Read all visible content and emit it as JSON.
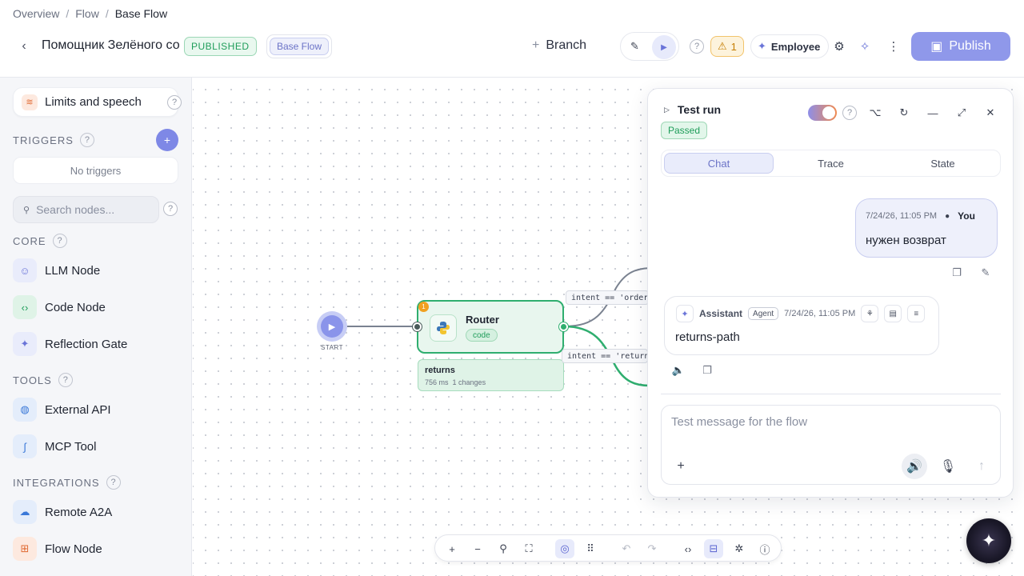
{
  "breadcrumb": {
    "items": [
      "Overview",
      "Flow"
    ],
    "current": "Base Flow"
  },
  "header": {
    "flow_title": "Помощник Зелёного со",
    "status_badge": "PUBLISHED",
    "flow_badge": "Base Flow",
    "branch_label": "Branch",
    "warnings_count": "1",
    "persona_label": "Employee",
    "publish_label": "Publish",
    "help_icon": "?"
  },
  "sidebar": {
    "limits_label": "Limits and speech",
    "triggers_title": "TRIGGERS",
    "no_triggers": "No triggers",
    "search_placeholder": "Search nodes...",
    "core_title": "CORE",
    "core_items": [
      {
        "label": "LLM Node",
        "icon": "robot-icon",
        "color": "#6a74d8"
      },
      {
        "label": "Code Node",
        "icon": "code-icon",
        "color": "#1f9d5a"
      },
      {
        "label": "Reflection Gate",
        "icon": "sparkle-icon",
        "color": "#6a74d8"
      }
    ],
    "tools_title": "TOOLS",
    "tools_items": [
      {
        "label": "External API",
        "icon": "globe-icon",
        "color": "#3a78d8"
      },
      {
        "label": "MCP Tool",
        "icon": "mcp-icon",
        "color": "#3a78d8"
      }
    ],
    "integrations_title": "INTEGRATIONS",
    "integrations_items": [
      {
        "label": "Remote A2A",
        "icon": "cloud-icon",
        "color": "#3a78d8"
      },
      {
        "label": "Flow Node",
        "icon": "flow-icon",
        "color": "#e06a33"
      }
    ]
  },
  "canvas": {
    "start_label": "START",
    "router": {
      "name": "Router",
      "tag": "code",
      "issue_count": "1"
    },
    "trace": {
      "title": "returns",
      "duration": "756 ms",
      "changes": "1 changes"
    },
    "edge_labels": [
      "intent == 'order'",
      "intent == 'returns"
    ]
  },
  "test_run": {
    "title": "Test run",
    "status": "Passed",
    "tabs": [
      "Chat",
      "Trace",
      "State"
    ],
    "active_tab": "Chat",
    "user_message": {
      "timestamp": "7/24/26, 11:05 PM",
      "author": "You",
      "text": "нужен возврат"
    },
    "assistant_message": {
      "author": "Assistant",
      "role": "Agent",
      "timestamp": "7/24/26, 11:05 PM",
      "text": "returns-path"
    },
    "composer_placeholder": "Test message for the flow"
  },
  "colors": {
    "accent": "#8f98ea",
    "success": "#2fae6f",
    "warning": "#f0a020"
  }
}
